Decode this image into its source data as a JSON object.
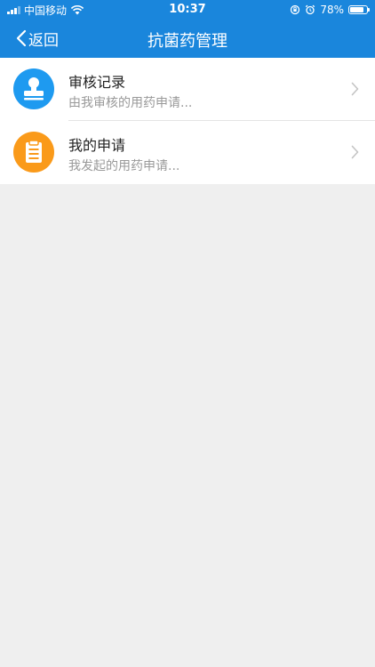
{
  "status_bar": {
    "carrier": "中国移动",
    "time": "10:37",
    "battery": "78%",
    "battery_level": 0.78
  },
  "nav": {
    "back_label": "返回",
    "title": "抗菌药管理"
  },
  "items": [
    {
      "title": "审核记录",
      "subtitle": "由我审核的用药申请...",
      "icon": "stamp-icon",
      "icon_color": "#1e9af0"
    },
    {
      "title": "我的申请",
      "subtitle": "我发起的用药申请...",
      "icon": "clipboard-icon",
      "icon_color": "#fa9a1a"
    }
  ],
  "colors": {
    "nav_background": "#1a86dc",
    "page_background": "#efefef"
  }
}
